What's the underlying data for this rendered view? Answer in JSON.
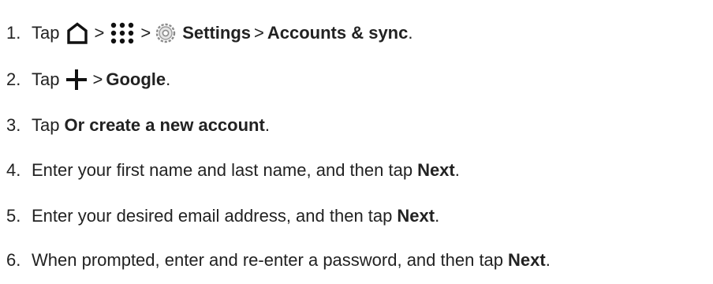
{
  "steps": [
    {
      "number": "1.",
      "tap": "Tap",
      "home_icon": "home-icon",
      "sep1": ">",
      "apps_icon": "apps-grid-icon",
      "sep2": ">",
      "settings_icon": "gear-icon",
      "settings": "Settings",
      "sep3": ">",
      "accounts": "Accounts & sync",
      "end": "."
    },
    {
      "number": "2.",
      "tap": "Tap",
      "plus_icon": "plus-icon",
      "sep1": ">",
      "google": "Google",
      "end": "."
    },
    {
      "number": "3.",
      "tap": "Tap",
      "create": "Or create a new account",
      "end": "."
    },
    {
      "number": "4.",
      "text": "Enter your first name and last name, and then tap",
      "next": "Next",
      "end": "."
    },
    {
      "number": "5.",
      "text": "Enter your desired email address, and then tap",
      "next": "Next",
      "end": "."
    },
    {
      "number": "6.",
      "text": "When prompted, enter and re-enter a password, and then tap",
      "next": "Next",
      "end": "."
    }
  ]
}
